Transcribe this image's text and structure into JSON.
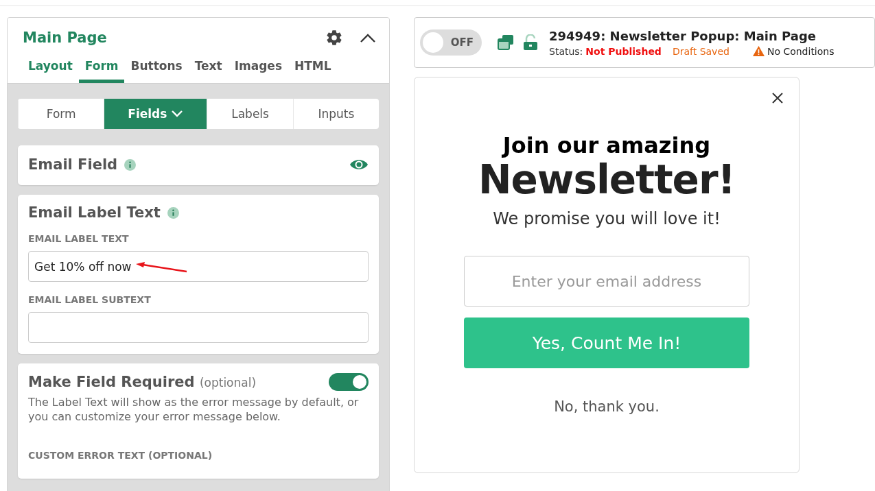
{
  "panel": {
    "title": "Main Page",
    "tabs": [
      {
        "label": "Layout",
        "selected": false
      },
      {
        "label": "Form",
        "selected": true
      },
      {
        "label": "Buttons",
        "selected": false
      },
      {
        "label": "Text",
        "selected": false
      },
      {
        "label": "Images",
        "selected": false
      },
      {
        "label": "HTML",
        "selected": false
      }
    ],
    "subtabs": [
      {
        "label": "Form",
        "selected": false,
        "dropdown": false
      },
      {
        "label": "Fields",
        "selected": true,
        "dropdown": true
      },
      {
        "label": "Labels",
        "selected": false,
        "dropdown": false
      },
      {
        "label": "Inputs",
        "selected": false,
        "dropdown": false
      }
    ],
    "email_field": {
      "title": "Email Field",
      "visible": true
    },
    "label_card": {
      "title": "Email Label Text",
      "fields": [
        {
          "label": "EMAIL LABEL TEXT",
          "value": "Get 10% off now",
          "annotated": true
        },
        {
          "label": "EMAIL LABEL SUBTEXT",
          "annotated": false
        }
      ]
    },
    "required_card": {
      "title": "Make Field Required",
      "note": "(optional)",
      "on": true,
      "description": "The Label Text will show as the error message by default, or you can customize your error message below.",
      "field_label": "CUSTOM ERROR TEXT (OPTIONAL)"
    }
  },
  "header": {
    "toggle": {
      "label": "OFF",
      "on": false
    },
    "title": "294949: Newsletter Popup: Main Page",
    "status_label": "Status:",
    "status": "Not Published",
    "draft": "Draft Saved",
    "conditions": "No Conditions"
  },
  "popup": {
    "heading": "Join our amazing",
    "headline": "Newsletter!",
    "subheading": "We promise you will love it!",
    "email_placeholder": "Enter your email address",
    "submit": "Yes, Count Me In!",
    "decline": "No, thank you."
  }
}
